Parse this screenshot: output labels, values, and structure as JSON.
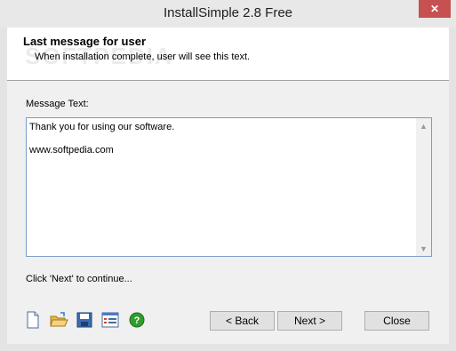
{
  "window": {
    "title": "InstallSimple 2.8 Free",
    "close_glyph": "✕"
  },
  "header": {
    "title": "Last message for user",
    "subtitle": "When installation complete, user will see this text.",
    "watermark": "SOFTPEDIA"
  },
  "message": {
    "label": "Message Text:",
    "text": "Thank you for using our software.\n\nwww.softpedia.com"
  },
  "hint": "Click 'Next' to continue...",
  "toolbar": {
    "icons": [
      "new-file-icon",
      "open-folder-icon",
      "save-icon",
      "properties-icon",
      "help-icon"
    ],
    "help_color": "#2f9e2f"
  },
  "buttons": {
    "back": "< Back",
    "next": "Next >",
    "close": "Close"
  }
}
